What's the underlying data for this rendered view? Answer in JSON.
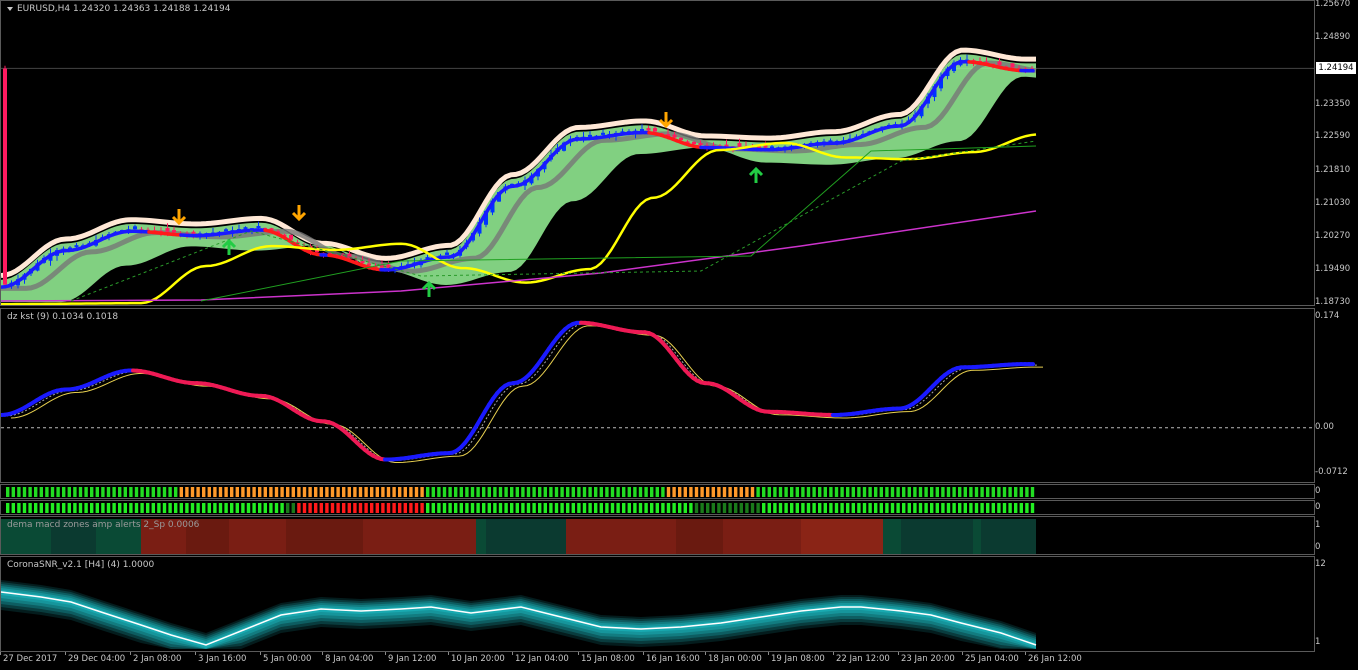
{
  "symbol_header": "EURUSD,H4  1.24320 1.24363 1.24188 1.24194",
  "current_price": "1.24194",
  "price_axis": [
    "1.25670",
    "1.24890",
    "1.24115",
    "1.23350",
    "1.22590",
    "1.21810",
    "1.21030",
    "1.20270",
    "1.19490",
    "1.18730"
  ],
  "kst_label": "dz kst (9) 0.1034 0.1018",
  "kst_axis": [
    "0.174",
    "0.00",
    "-0.0712"
  ],
  "macd_label": "dema macd zones amp alerts 2_Sp 0.0006",
  "macd_axis": [
    "1",
    "0"
  ],
  "bar1_axis": "0",
  "bar2_axis": "0",
  "snr_label": "CoronaSNR_v2.1 [H4] (4) 1.0000",
  "snr_axis": [
    "12",
    "1"
  ],
  "time_axis": [
    "27 Dec 2017",
    "29 Dec 04:00",
    "2 Jan 08:00",
    "3 Jan 16:00",
    "5 Jan 00:00",
    "8 Jan 04:00",
    "9 Jan 12:00",
    "10 Jan 20:00",
    "12 Jan 04:00",
    "15 Jan 08:00",
    "16 Jan 16:00",
    "18 Jan 00:00",
    "19 Jan 08:00",
    "22 Jan 12:00",
    "23 Jan 20:00",
    "25 Jan 04:00",
    "26 Jan 12:00"
  ],
  "colors": {
    "bull": "#0000ff",
    "bear": "#ff1a40",
    "ma_yellow": "#ffff00",
    "magenta": "#cc33cc",
    "green_arrow": "#22cc44",
    "orange_arrow": "#ffa500",
    "grid": "#5a5a5a"
  },
  "chart_data": {
    "type": "line",
    "title": "EURUSD,H4",
    "ylim": [
      1.1873,
      1.2567
    ],
    "x": [
      "27 Dec 2017",
      "29 Dec 04:00",
      "2 Jan 08:00",
      "3 Jan 16:00",
      "5 Jan 00:00",
      "8 Jan 04:00",
      "9 Jan 12:00",
      "10 Jan 20:00",
      "12 Jan 04:00",
      "15 Jan 08:00",
      "16 Jan 16:00",
      "18 Jan 00:00",
      "19 Jan 08:00",
      "22 Jan 12:00",
      "23 Jan 20:00",
      "25 Jan 04:00",
      "26 Jan 12:00"
    ],
    "series": [
      {
        "name": "EURUSD",
        "values": [
          1.1915,
          1.2,
          1.2045,
          1.2035,
          1.2048,
          1.199,
          1.1955,
          1.1985,
          1.215,
          1.226,
          1.2275,
          1.224,
          1.2235,
          1.225,
          1.229,
          1.244,
          1.2419
        ]
      }
    ],
    "kst": {
      "ylim": [
        -0.0712,
        0.174
      ],
      "values": [
        0.02,
        0.06,
        0.09,
        0.07,
        0.05,
        0.01,
        -0.05,
        -0.04,
        0.07,
        0.165,
        0.15,
        0.07,
        0.025,
        0.02,
        0.03,
        0.095,
        0.1
      ]
    }
  }
}
